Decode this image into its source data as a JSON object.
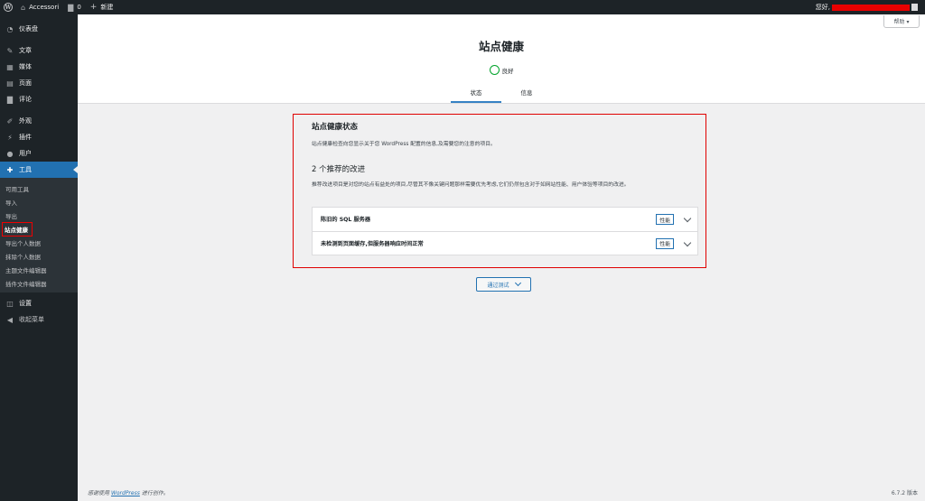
{
  "adminbar": {
    "site_name": "Accessori",
    "comments_count": "0",
    "new_label": "新建",
    "greeting": "您好,"
  },
  "sidebar": {
    "menu_top": [
      {
        "icon": "dashboard-icon",
        "label": "仪表盘"
      }
    ],
    "menu_content": [
      {
        "icon": "pin-icon",
        "label": "文章"
      },
      {
        "icon": "media-icon",
        "label": "媒体"
      },
      {
        "icon": "page-icon",
        "label": "页面"
      },
      {
        "icon": "comment-icon",
        "label": "评论"
      }
    ],
    "menu_site": [
      {
        "icon": "appearance-icon",
        "label": "外观"
      },
      {
        "icon": "plugin-icon",
        "label": "插件"
      },
      {
        "icon": "user-icon",
        "label": "用户"
      },
      {
        "icon": "wrench-icon",
        "label": "工具"
      }
    ],
    "tools_submenu": [
      "可用工具",
      "导入",
      "导出",
      "站点健康",
      "导出个人数据",
      "抹除个人数据",
      "主题文件编辑器",
      "插件文件编辑器"
    ],
    "menu_bottom": [
      {
        "icon": "settings-icon",
        "label": "设置"
      },
      {
        "icon": "collapse-icon",
        "label": "收起菜单"
      }
    ]
  },
  "header": {
    "help_label": "帮助 ▾",
    "title": "站点健康",
    "status_text": "良好",
    "tabs": [
      "状态",
      "信息"
    ]
  },
  "main": {
    "heading": "站点健康状态",
    "description": "站点健康检查向您显示关于您 WordPress 配置的信息,及需要您的注意的项目。",
    "improvements_heading": "2 个推荐的改进",
    "improvements_description": "推荐改进项目是对您的站点有益处的项目,尽管其不像关键问题那样需要优先考虑,它们仍然包含对于如网站性能、用户体验等项目的改进。",
    "issues": [
      {
        "label": "陈旧的 SQL 服务器",
        "badge": "性能"
      },
      {
        "label": "未检测到页面缓存,但服务器响应时间正常",
        "badge": "性能"
      }
    ],
    "passed_button": "通过测试"
  },
  "footer": {
    "thanks_pre": "感谢使用",
    "thanks_link": "WordPress",
    "thanks_post": "进行创作。",
    "version": "6.7.2 版本"
  },
  "colors": {
    "accent": "#2271b1",
    "sidebar_bg": "#1d2327",
    "good_status": "#00a32a",
    "highlight_border": "#e00000"
  }
}
